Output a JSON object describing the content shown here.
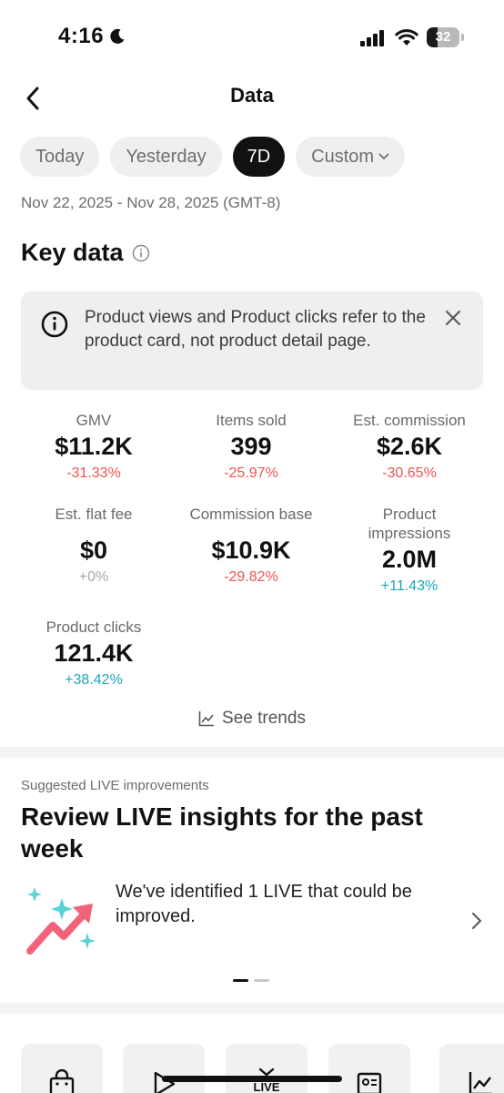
{
  "status_bar": {
    "time": "4:16",
    "battery": "32",
    "battery_level": 0.32
  },
  "header": {
    "title": "Data",
    "back_icon": "chevron-left-icon"
  },
  "tabs": [
    {
      "label": "Today"
    },
    {
      "label": "Yesterday"
    },
    {
      "label": "7D",
      "active": true
    },
    {
      "label": "Custom",
      "icon": "chevron-down-icon"
    }
  ],
  "date_range": "Nov 22, 2025 - Nov 28, 2025 (GMT-8)",
  "key_data": {
    "title": "Key data",
    "notice": "Product views and Product clicks refer to the product card, not product detail page.",
    "metrics": [
      {
        "label": "GMV",
        "value": "$11.2K",
        "change": "-31.33%",
        "trend": "negative"
      },
      {
        "label": "Items sold",
        "value": "399",
        "change": "-25.97%",
        "trend": "negative"
      },
      {
        "label": "Est. commission",
        "value": "$2.6K",
        "change": "-30.65%",
        "trend": "negative"
      },
      {
        "label": "Est. flat fee",
        "value": "$0",
        "change": "+0%",
        "trend": "neutral"
      },
      {
        "label": "Commission base",
        "value": "$10.9K",
        "change": "-29.82%",
        "trend": "negative"
      },
      {
        "label": "Product impressions",
        "value": "2.0M",
        "change": "+11.43%",
        "trend": "positive"
      },
      {
        "label": "Product clicks",
        "value": "121.4K",
        "change": "+38.42%",
        "trend": "positive"
      }
    ],
    "see_trends": "See trends"
  },
  "suggestions": {
    "label": "Suggested LIVE improvements",
    "title": "Review LIVE insights for the past week",
    "text": "We've identified 1 LIVE that could be improved.",
    "page_count": 2,
    "active_page": 1
  },
  "tools": [
    {
      "icon": "shopping-bag-icon"
    },
    {
      "icon": "play-icon"
    },
    {
      "icon": "live-tv-icon",
      "label": "LIVE"
    },
    {
      "icon": "id-card-icon"
    },
    {
      "icon": "chart-icon"
    }
  ],
  "colors": {
    "negative": "#ef5350",
    "positive": "#1aa8b8",
    "neutral": "#a8a8a8",
    "active_tab": "#111111"
  }
}
